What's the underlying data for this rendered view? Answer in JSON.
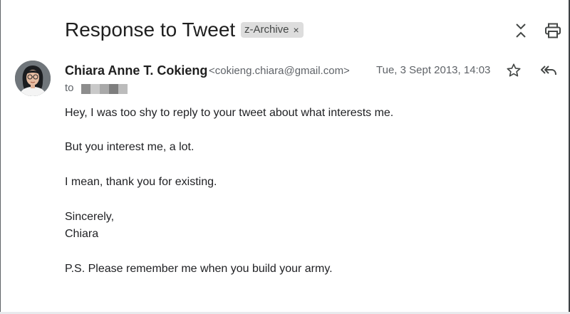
{
  "email": {
    "subject": "Response to Tweet",
    "label": "z-Archive",
    "label_remove": "×",
    "sender": {
      "name": "Chiara Anne T. Cokieng",
      "email": "<cokieng.chiara@gmail.com>"
    },
    "date": "Tue, 3 Sept 2013, 14:03",
    "to_label": "to",
    "body": {
      "line1": "Hey, I was too shy to reply to your tweet about what interests me.",
      "line2": "But you interest me, a lot.",
      "line3": "I mean, thank you for existing.",
      "line4": "Sincerely,",
      "line5": "Chiara",
      "line6": "P.S. Please remember me when you build your army."
    }
  },
  "icons": {
    "expand": "expand-collapse-icon",
    "print": "print-icon",
    "star": "star-icon",
    "reply": "reply-all-icon"
  },
  "colors": {
    "chip_background": "#dddddd",
    "text_primary": "#202124",
    "text_secondary": "#5f6368"
  }
}
